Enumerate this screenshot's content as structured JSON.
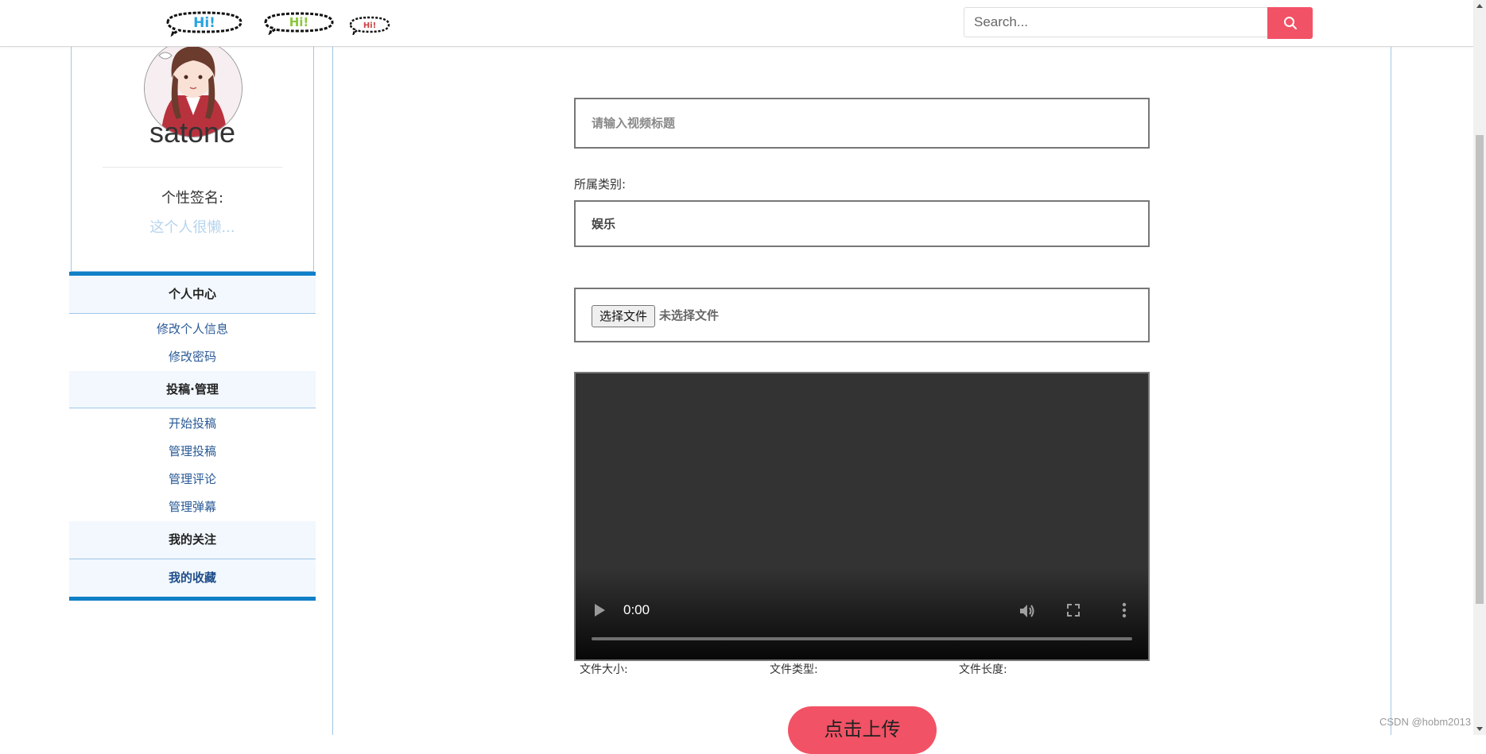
{
  "header": {
    "logos": [
      "Hi!",
      "Hi!",
      "Hi!"
    ],
    "search": {
      "placeholder": "Search...",
      "value": "",
      "icon": "search-icon"
    }
  },
  "profile": {
    "username": "satone",
    "signature_label": "个性签名:",
    "signature_value": "这个人很懒..."
  },
  "menu": {
    "personal_center": "个人中心",
    "edit_info": "修改个人信息",
    "change_password": "修改密码",
    "submission_manage": "投稿·管理",
    "start_submit": "开始投稿",
    "manage_submissions": "管理投稿",
    "manage_comments": "管理评论",
    "manage_danmaku": "管理弹幕",
    "my_follows": "我的关注",
    "my_favorites": "我的收藏"
  },
  "form": {
    "title_placeholder": "请输入视频标题",
    "category_label": "所属类别:",
    "category_value": "娱乐",
    "file_button": "选择文件",
    "file_status": "未选择文件",
    "video_time": "0:00",
    "file_size_label": "文件大小:",
    "file_type_label": "文件类型:",
    "file_length_label": "文件长度:",
    "upload_button": "点击上传"
  },
  "watermark": "CSDN @hobm2013",
  "colors": {
    "accent": "#f25265",
    "menu_border": "#0f7fc6",
    "light_border": "#9fc7e8",
    "link": "#2a5a96"
  }
}
